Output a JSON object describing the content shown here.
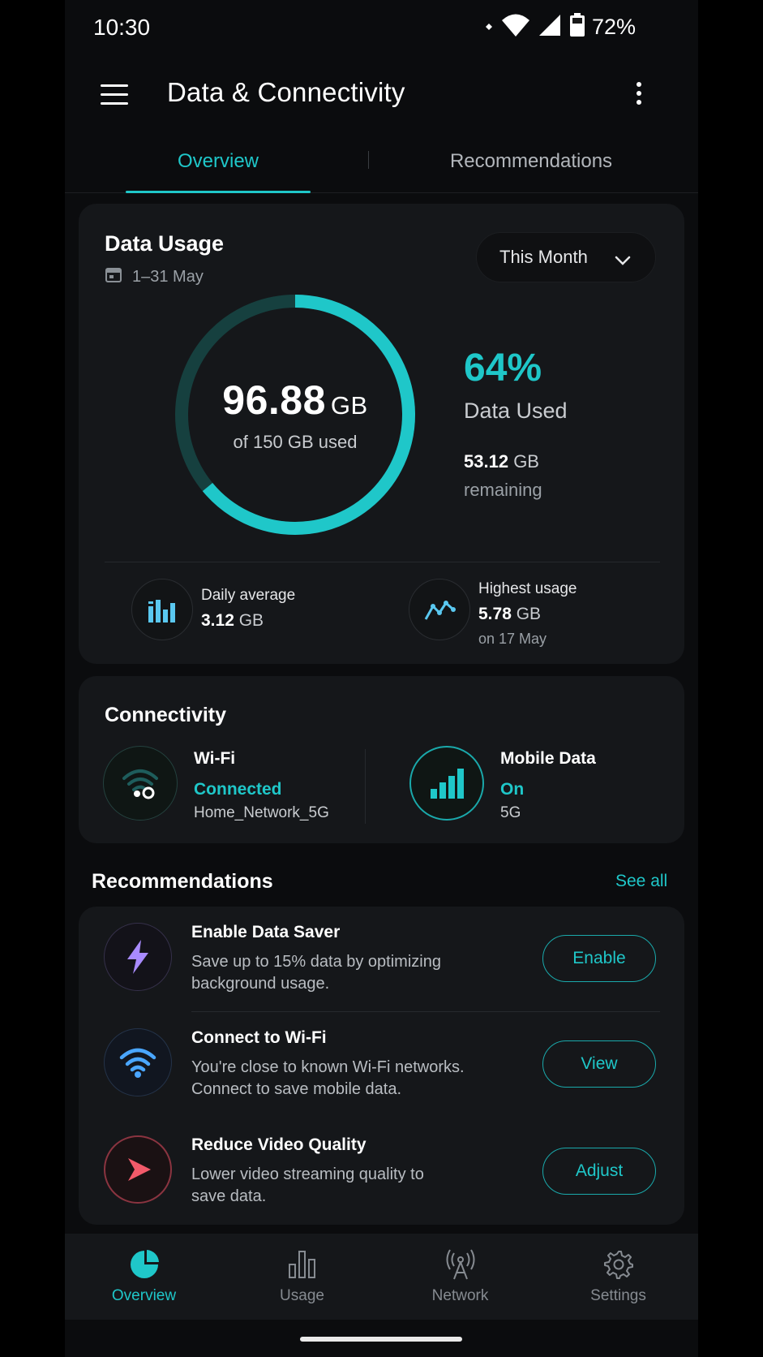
{
  "status_bar": {
    "time": "10:30",
    "battery_percent": "72%"
  },
  "app_bar": {
    "title": "Data & Connectivity"
  },
  "tabs": [
    {
      "label": "Overview",
      "active": true
    },
    {
      "label": "Recommendations",
      "active": false
    }
  ],
  "data_usage": {
    "title": "Data Usage",
    "date_range": "1–31 May",
    "period": "This Month",
    "used_value": "96.88",
    "used_unit": "GB",
    "used_caption": "of 150 GB used",
    "used_fraction": 0.64,
    "percent": "64%",
    "percent_label": "Data Used",
    "remaining_value": "53.12",
    "remaining_unit": "GB",
    "remaining_label": "remaining",
    "daily_average": {
      "label": "Daily average",
      "value": "3.12",
      "unit": "GB"
    },
    "highest_usage": {
      "label": "Highest usage",
      "value": "5.78",
      "unit": "GB",
      "note": "on 17 May"
    }
  },
  "connectivity": {
    "title": "Connectivity",
    "wifi": {
      "name": "Wi-Fi",
      "status": "Connected",
      "detail": "Home_Network_5G"
    },
    "mobile": {
      "name": "Mobile Data",
      "status": "On",
      "detail": "5G"
    }
  },
  "recommendations": {
    "title": "Recommendations",
    "see_all": "See all",
    "items": [
      {
        "title": "Enable Data Saver",
        "description": "Save up to 15% data by optimizing background usage.",
        "action": "Enable",
        "icon": "lightning-icon"
      },
      {
        "title": "Connect to Wi-Fi",
        "description": "You're close to known Wi-Fi networks. Connect to save mobile data.",
        "action": "View",
        "icon": "wifi-icon"
      },
      {
        "title": "Reduce Video Quality",
        "description": "Lower video streaming quality to save data.",
        "action": "Adjust",
        "icon": "play-icon"
      }
    ]
  },
  "bottom_nav": [
    {
      "label": "Overview",
      "icon": "pie-chart-icon",
      "active": true
    },
    {
      "label": "Usage",
      "icon": "bar-chart-icon",
      "active": false
    },
    {
      "label": "Network",
      "icon": "antenna-icon",
      "active": false
    },
    {
      "label": "Settings",
      "icon": "gear-icon",
      "active": false
    }
  ],
  "colors": {
    "accent": "#1fc7c9",
    "background": "#0b0c0e",
    "card": "#15171a",
    "purple": "#a98bff",
    "blue": "#4aa6ff",
    "red": "#f25a6a"
  }
}
